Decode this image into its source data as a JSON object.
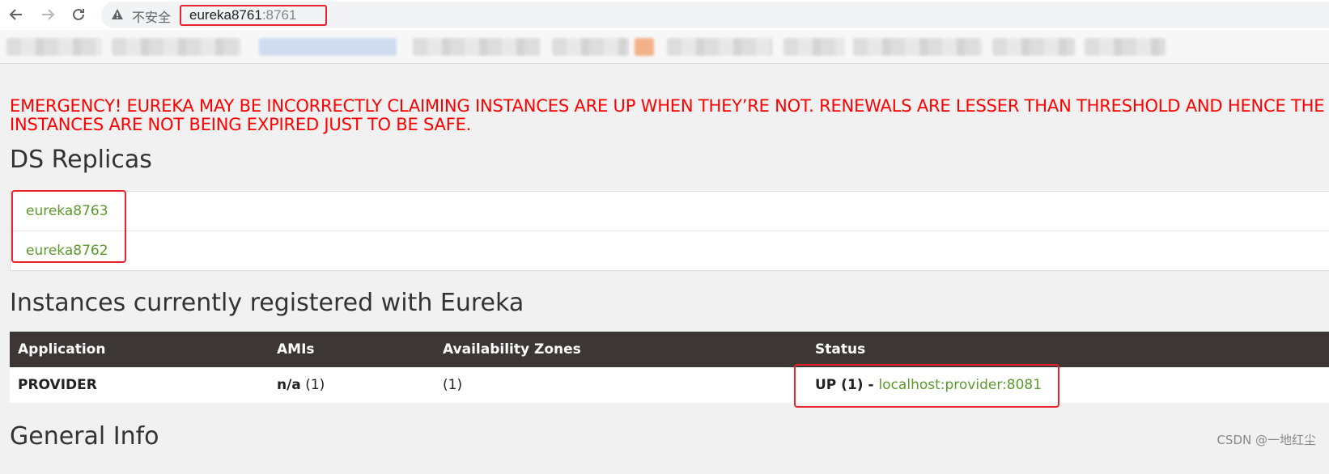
{
  "browser": {
    "back_icon": "arrow-left-icon",
    "forward_icon": "arrow-right-icon",
    "reload_icon": "reload-icon",
    "security_icon": "warning-triangle-icon",
    "security_label": "不安全",
    "url_host": "eureka8761",
    "url_port": ":8761"
  },
  "page": {
    "emergency_line1": "EMERGENCY! EUREKA MAY BE INCORRECTLY CLAIMING INSTANCES ARE UP WHEN THEY’RE NOT. RENEWALS ARE LESSER THAN THRESHOLD AND HENCE THE",
    "emergency_line2": "INSTANCES ARE NOT BEING EXPIRED JUST TO BE SAFE.",
    "ds_replicas_title": "DS Replicas",
    "replicas": [
      {
        "label": "eureka8763"
      },
      {
        "label": "eureka8762"
      }
    ],
    "instances_title": "Instances currently registered with Eureka",
    "instances_table": {
      "headers": [
        "Application",
        "AMIs",
        "Availability Zones",
        "Status"
      ],
      "rows": [
        {
          "application": "PROVIDER",
          "amis_bold": "n/a",
          "amis_count": " (1)",
          "zones": "(1)",
          "status_text": "UP (1) - ",
          "status_link": "localhost:provider:8081"
        }
      ]
    },
    "general_info_title": "General Info"
  },
  "watermark": "CSDN @一地红尘",
  "colors": {
    "emergency": "#ff0000",
    "link_green": "#5a9a2b",
    "table_header_bg": "#3c3734",
    "highlight_box": "#e8232b"
  }
}
